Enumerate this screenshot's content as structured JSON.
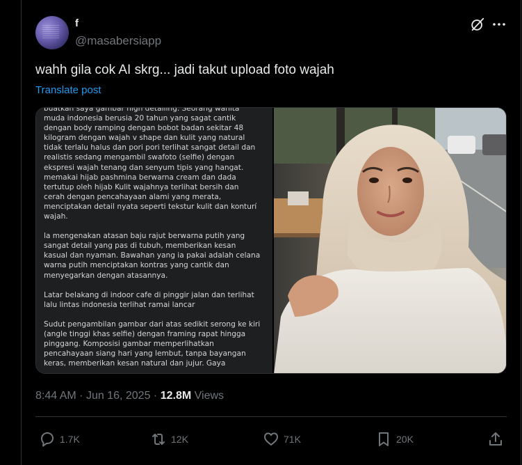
{
  "author": {
    "display_name": "f",
    "handle": "@masabersiapp"
  },
  "post": {
    "text": "wahh gila cok AI skrg... jadi takut upload foto wajah",
    "translate_label": "Translate post",
    "media_text_paragraphs": [
      "buatkan saya gambar high detailing. Seorang wanita muda indonesia berusia 20 tahun yang sagat cantik dengan body ramping dengan bobot badan sekitar 48 kilogram dengan wajah v shape dan kulit yang natural tidak terlalu halus dan pori pori terlihat sangat detail dan realistis sedang mengambil swafoto (selfie) dengan ekspresi wajah tenang dan senyum tipis yang hangat. memakai hijab pashmina berwarna cream dan dada tertutup oleh hijab Kulit wajahnya terlihat bersih dan cerah dengan pencahayaan alami yang merata, menciptakan detail nyata seperti tekstur kulit dan konturí wajah.",
      "la mengenakan atasan baju rajut berwarna putih yang sangat detail yang pas di tubuh, memberikan kesan kasual dan nyaman. Bawahan yang ia pakai adalah celana warna putih menciptakan kontras yang cantik dan menyegarkan dengan atasannya.",
      "Latar belakang di indoor cafe di pinggir jalan dan terlihat lalu lintas indonesia terlihat ramai lancar",
      "Sudut pengambilan gambar dari atas sedikit serong ke kiri (angle tinggi khas selfie) dengan framing rapat hingga pinggang. Komposisi gambar memperlihatkan pencahayaan siang hari yang lembut, tanpa bayangan keras, memberikan kesan natural dan jujur. Gaya"
    ],
    "time": "8:44 AM",
    "date": "Jun 16, 2025",
    "views_count": "12.8M",
    "views_label": "Views"
  },
  "actions": {
    "replies": "1.7K",
    "reposts": "12K",
    "likes": "71K",
    "bookmarks": "20K"
  },
  "icons": {
    "grok": "grok-icon",
    "more": "more-icon",
    "reply": "reply-icon",
    "repost": "repost-icon",
    "like": "heart-icon",
    "bookmark": "bookmark-icon",
    "share": "share-icon"
  },
  "colors": {
    "background": "#000000",
    "text": "#e7e9ea",
    "muted": "#71767b",
    "link": "#1d9bf0",
    "border": "#2f3336"
  }
}
